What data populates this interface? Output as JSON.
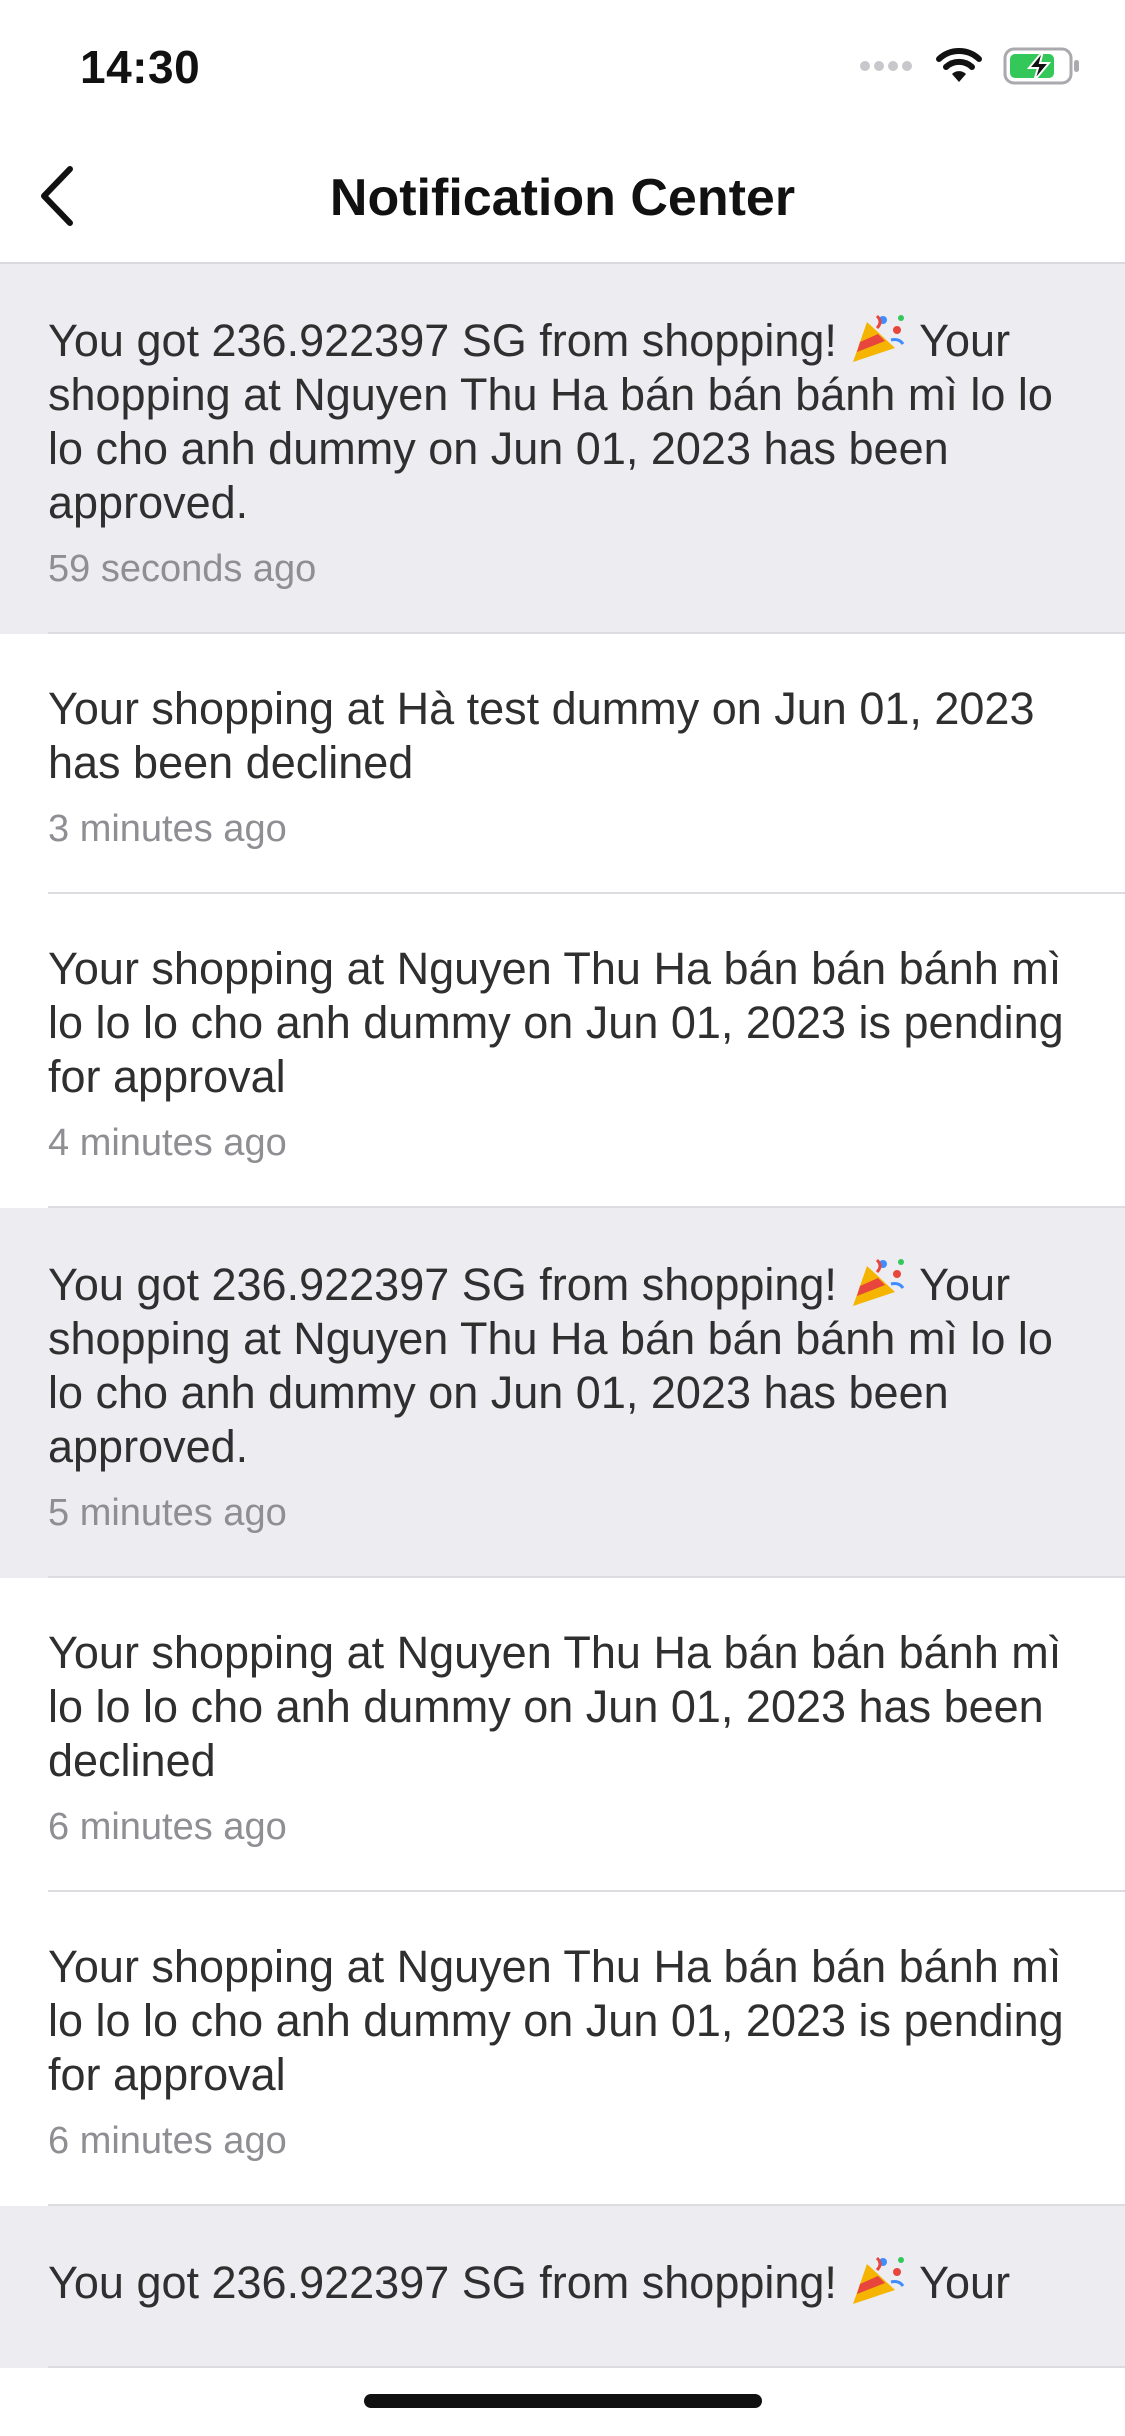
{
  "status_bar": {
    "time": "14:30"
  },
  "nav": {
    "title": "Notification Center",
    "back_icon": "chevron-left-icon"
  },
  "notifications": [
    {
      "type": "reward",
      "part1": "You got 236.922397 SG from shopping! ",
      "emoji": "party-popper-icon",
      "part2": " Your shopping at Nguyen Thu Ha bán bán bánh mì lo lo lo cho anh dummy on Jun 01, 2023 has been approved.",
      "time": "59 seconds ago"
    },
    {
      "type": "plain",
      "message": "Your shopping at Hà test dummy on Jun 01, 2023 has been declined",
      "time": "3 minutes ago"
    },
    {
      "type": "plain",
      "message": "Your shopping at Nguyen Thu Ha bán bán bánh mì lo lo lo cho anh dummy on Jun 01, 2023 is pending for approval",
      "time": "4 minutes ago"
    },
    {
      "type": "reward",
      "part1": "You got 236.922397 SG from shopping! ",
      "emoji": "party-popper-icon",
      "part2": " Your shopping at Nguyen Thu Ha bán bán bánh mì lo lo lo cho anh dummy on Jun 01, 2023 has been approved.",
      "time": "5 minutes ago"
    },
    {
      "type": "plain",
      "message": "Your shopping at Nguyen Thu Ha bán bán bánh mì lo lo lo cho anh dummy on Jun 01, 2023 has been declined",
      "time": "6 minutes ago"
    },
    {
      "type": "plain",
      "message": "Your shopping at Nguyen Thu Ha bán bán bánh mì lo lo lo cho anh dummy on Jun 01, 2023 is pending for approval",
      "time": "6 minutes ago"
    },
    {
      "type": "reward",
      "part1": "You got 236.922397 SG from shopping! ",
      "emoji": "party-popper-icon",
      "part2": " Your",
      "time": ""
    }
  ],
  "colors": {
    "reward_background": "#ececf1",
    "plain_background": "#ffffff",
    "timestamp": "#8e8e93",
    "battery_fill": "#34c759"
  }
}
